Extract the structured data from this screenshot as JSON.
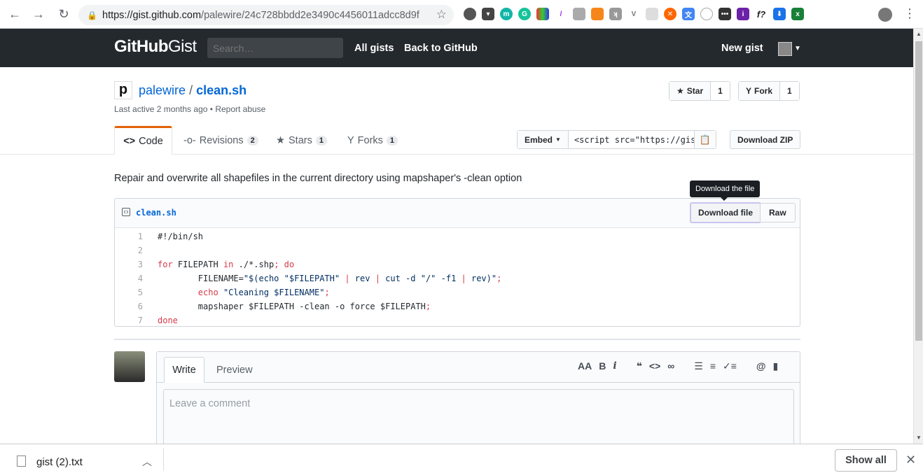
{
  "browser": {
    "url_host": "https://gist.github.com",
    "url_path": "/palewire/24c728bbdd2e3490c4456011adcc8d9f"
  },
  "header": {
    "logo_main": "GitHub",
    "logo_sub": "Gist",
    "search_placeholder": "Search…",
    "nav": [
      "All gists",
      "Back to GitHub"
    ],
    "new_gist": "New gist"
  },
  "gist": {
    "owner_initial": "p",
    "owner": "palewire",
    "separator": "/",
    "filename": "clean.sh",
    "last_active": "Last active 2 months ago",
    "bullet": "•",
    "report": "Report abuse",
    "star_label": "Star",
    "star_count": "1",
    "fork_label": "Fork",
    "fork_count": "1"
  },
  "tabs": {
    "code": "Code",
    "revisions": "Revisions",
    "revisions_count": "2",
    "stars": "Stars",
    "stars_count": "1",
    "forks": "Forks",
    "forks_count": "1"
  },
  "embed": {
    "label": "Embed",
    "value": "<script src=\"https://gis",
    "download_zip": "Download ZIP"
  },
  "description": "Repair and overwrite all shapefiles in the current directory using mapshaper's -clean option",
  "file": {
    "name": "clean.sh",
    "download": "Download file",
    "raw": "Raw",
    "tooltip": "Download the file"
  },
  "comment": {
    "write": "Write",
    "preview": "Preview",
    "placeholder": "Leave a comment"
  },
  "downloads": {
    "filename": "gist (2).txt",
    "show_all": "Show all"
  }
}
